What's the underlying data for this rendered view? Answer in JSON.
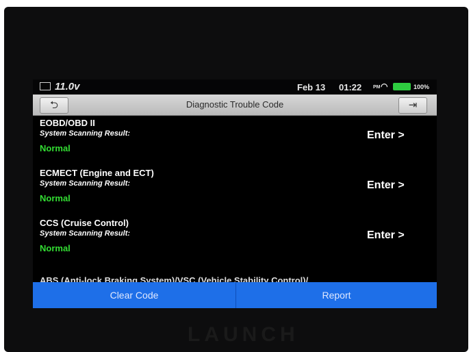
{
  "device": {
    "brand": "LAUNCH"
  },
  "status_bar": {
    "voltage": "11.0v",
    "date": "Feb 13",
    "time": "01:22",
    "ampm": "PM",
    "battery": "100%"
  },
  "toolbar": {
    "title": "Diagnostic Trouble Code",
    "back_icon": "back-arrow-icon",
    "exit_icon": "exit-icon"
  },
  "systems": [
    {
      "name": "EOBD/OBD II",
      "label": "System Scanning Result:",
      "result": "Normal",
      "action": "Enter >"
    },
    {
      "name": "ECMECT (Engine and ECT)",
      "label": "System Scanning Result:",
      "result": "Normal",
      "action": "Enter >"
    },
    {
      "name": "CCS (Cruise Control)",
      "label": "System Scanning Result:",
      "result": "Normal",
      "action": "Enter >"
    }
  ],
  "partial_item": "ABS (Anti-lock Braking System)/VSC (Vehicle Stability Control)/",
  "bottom_bar": {
    "clear_code": "Clear Code",
    "report": "Report"
  },
  "colors": {
    "result_ok": "#33dd33",
    "bottom_bar": "#1e6fe8"
  }
}
